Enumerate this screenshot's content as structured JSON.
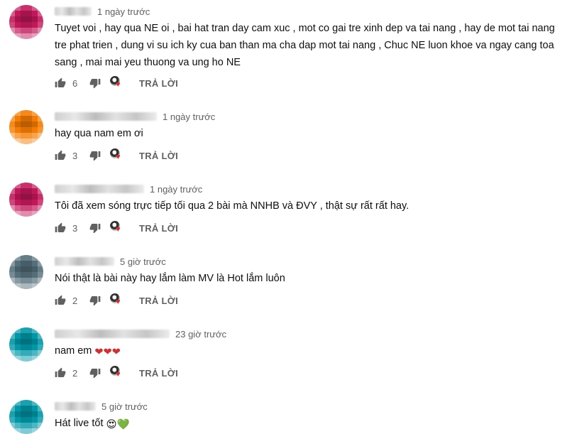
{
  "comments": [
    {
      "time": "1 ngày trước",
      "text": "Tuyet voi , hay qua NE oi , bai hat tran day cam xuc , mot co gai tre xinh dep va tai nang , hay de mot tai nang tre phat trien , dung vi su ich ky cua ban than ma cha dap mot tai nang , Chuc NE luon khoe va ngay cang toa sang , mai mai yeu thuong va ung ho NE",
      "likes": "6",
      "reply_label": "TRẢ LỜI",
      "avatar_color": "#c2185b"
    },
    {
      "time": "1 ngày trước",
      "text": "hay qua nam em ơi",
      "likes": "3",
      "reply_label": "TRẢ LỜI",
      "avatar_color": "#f57c00"
    },
    {
      "time": "1 ngày trước",
      "text": "Tôi đã xem sóng trực tiếp tối qua 2 bài mà NNHB và ĐVY , thật sự rất rất hay.",
      "likes": "3",
      "reply_label": "TRẢ LỜI",
      "avatar_color": "#c2185b"
    },
    {
      "time": "5 giờ trước",
      "text": "Nói thật là bài này hay lắm làm MV là Hot lắm luôn",
      "likes": "2",
      "reply_label": "TRẢ LỜI",
      "avatar_color": "#546e7a"
    },
    {
      "time": "23 giờ trước",
      "text": "nam em",
      "text_emoji": "❤❤❤",
      "likes": "2",
      "reply_label": "TRẢ LỜI",
      "avatar_color": "#0097a7"
    },
    {
      "time": "5 giờ trước",
      "text": "Hát live tốt",
      "text_emoji": "😍💚",
      "avatar_color": "#0097a7"
    }
  ],
  "icons": {
    "like": "thumb-up-icon",
    "dislike": "thumb-down-icon",
    "creator_heart": "creator-heart-icon"
  },
  "colors": {
    "secondary_text": "#606060",
    "heart": "#e0262d"
  }
}
